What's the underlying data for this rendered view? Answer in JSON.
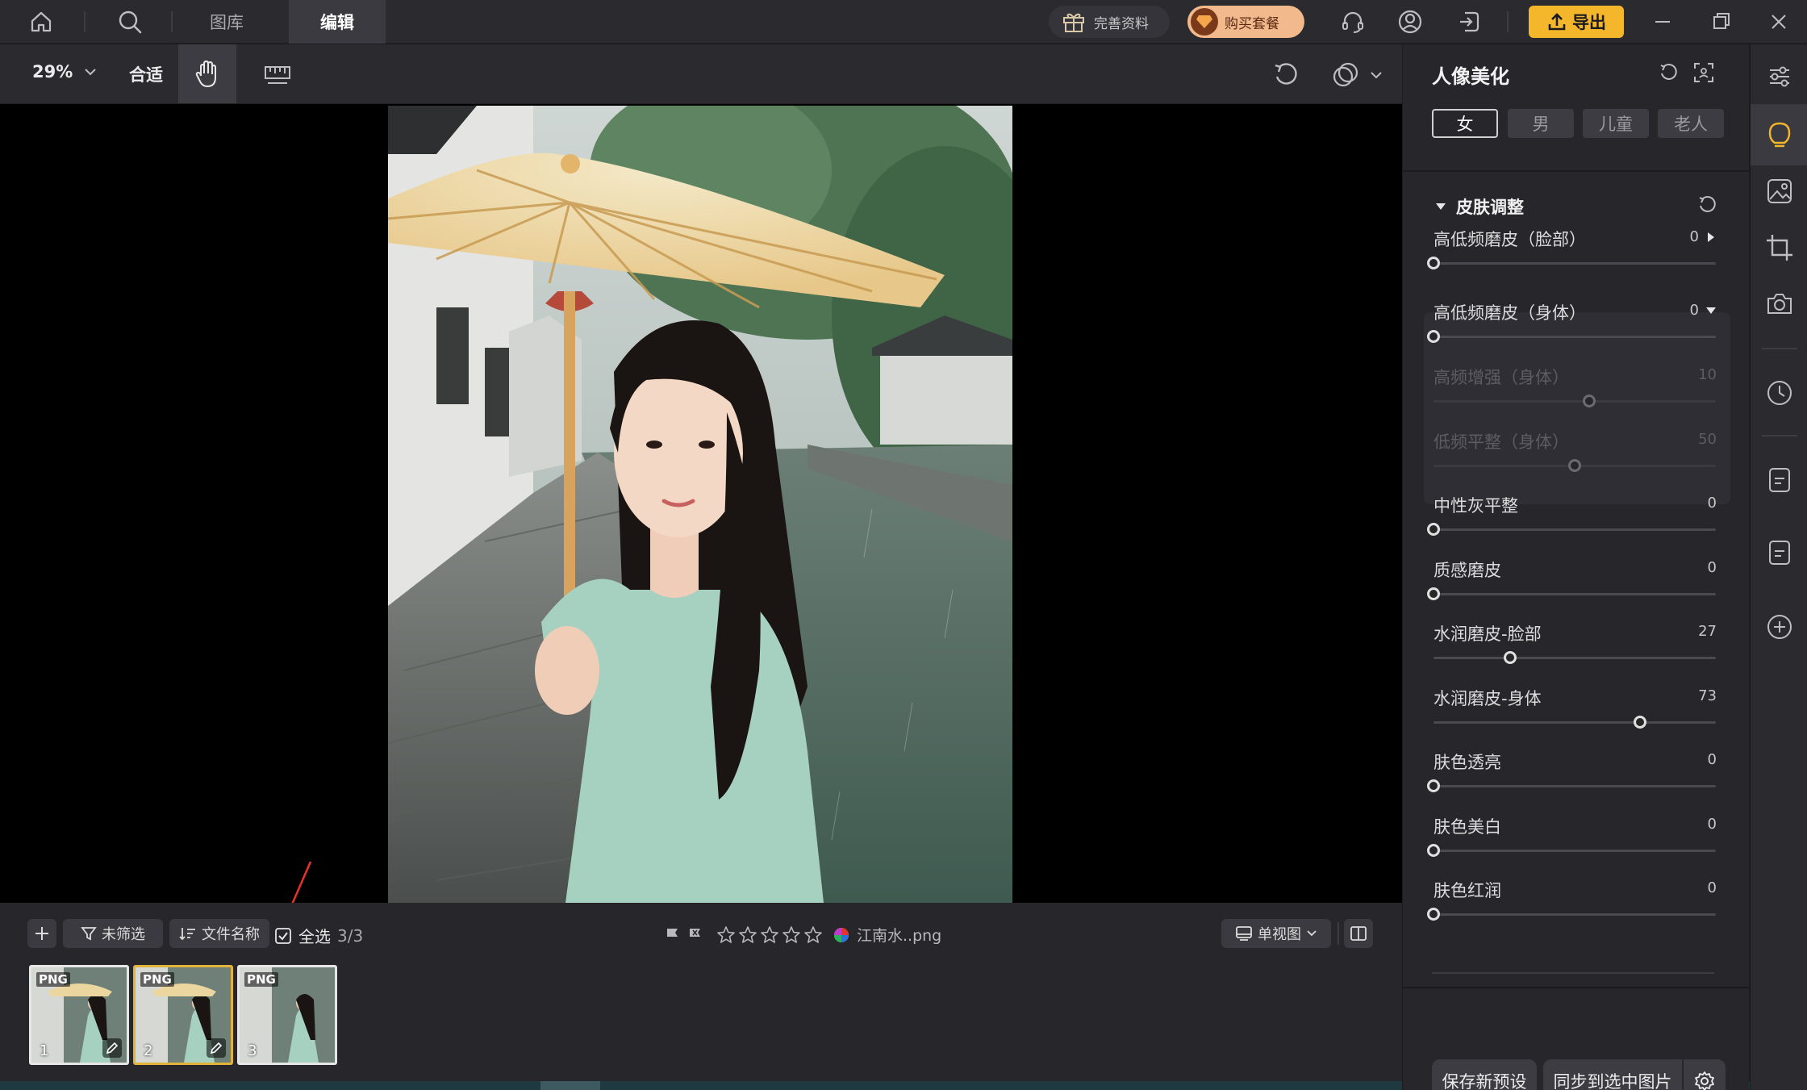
{
  "titlebar": {
    "tabs": [
      {
        "label": "图库",
        "active": false
      },
      {
        "label": "编辑",
        "active": true
      }
    ],
    "gift_label": "完善资料",
    "buy_label": "购买套餐",
    "export_label": "导出"
  },
  "toolbar": {
    "zoom": "29%",
    "fit_label": "合适"
  },
  "filmstrip": {
    "filter_label": "未筛选",
    "sort_label": "文件名称",
    "select_all_label": "全选",
    "count": "3/3",
    "filename": "江南水..png",
    "view_label": "单视图",
    "rating": 0,
    "thumbs": [
      {
        "tag": "PNG",
        "num": "1",
        "selected": false,
        "edited": true
      },
      {
        "tag": "PNG",
        "num": "2",
        "selected": true,
        "edited": true
      },
      {
        "tag": "PNG",
        "num": "3",
        "selected": false,
        "edited": false
      }
    ]
  },
  "panel": {
    "title": "人像美化",
    "segments": [
      {
        "label": "女",
        "active": true
      },
      {
        "label": "男",
        "active": false
      },
      {
        "label": "儿童",
        "active": false
      },
      {
        "label": "老人",
        "active": false
      }
    ],
    "section_title": "皮肤调整",
    "sliders": [
      {
        "label": "高低频磨皮（脸部）",
        "value": 0,
        "max": 100,
        "enabled": true,
        "arrow": "right"
      },
      {
        "label": "高低频磨皮（身体）",
        "value": 0,
        "max": 100,
        "enabled": true,
        "arrow": "down"
      },
      {
        "label": "高频增强（身体）",
        "value": 10,
        "min": -100,
        "max": 100,
        "enabled": false
      },
      {
        "label": "低频平整（身体）",
        "value": 50,
        "max": 100,
        "enabled": false
      },
      {
        "label": "中性灰平整",
        "value": 0,
        "max": 100,
        "enabled": true
      },
      {
        "label": "质感磨皮",
        "value": 0,
        "max": 100,
        "enabled": true
      },
      {
        "label": "水润磨皮-脸部",
        "value": 27,
        "max": 100,
        "enabled": true
      },
      {
        "label": "水润磨皮-身体",
        "value": 73,
        "max": 100,
        "enabled": true
      },
      {
        "label": "肤色透亮",
        "value": 0,
        "max": 100,
        "enabled": true
      },
      {
        "label": "肤色美白",
        "value": 0,
        "max": 100,
        "enabled": true
      },
      {
        "label": "肤色红润",
        "value": 0,
        "max": 100,
        "enabled": true
      }
    ],
    "save_preset_label": "保存新预设",
    "sync_label": "同步到选中图片"
  },
  "colors": {
    "accent_yellow": "#f4b62a",
    "buy_pill": "#f2b98c",
    "arrow_red": "#e8322a"
  }
}
